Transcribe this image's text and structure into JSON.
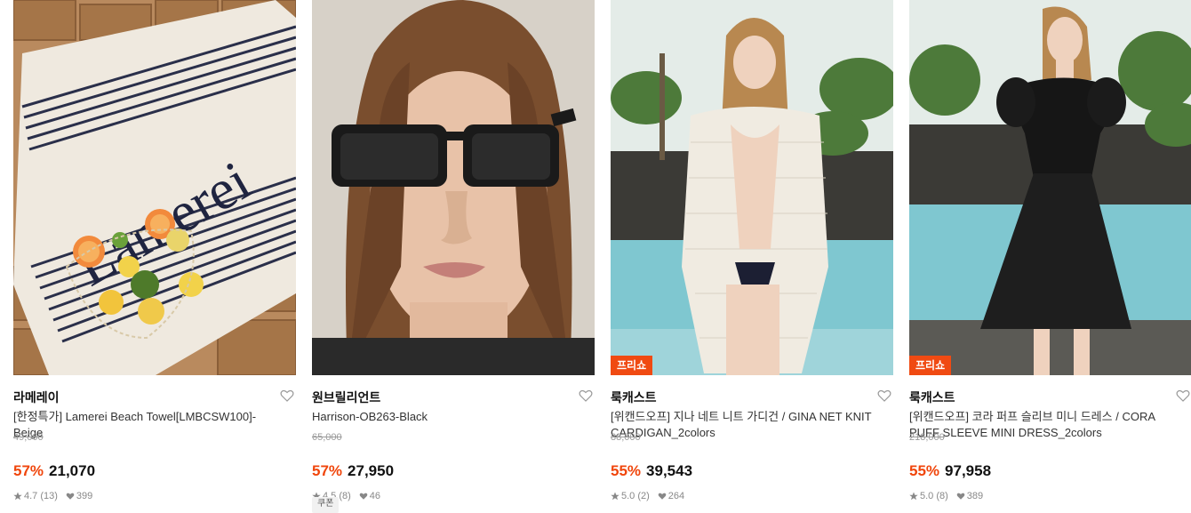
{
  "products": [
    {
      "brand": "라메레이",
      "name": "[한정특가] Lamerei Beach Towel[LMBCSW100]-Beige",
      "original_price": "49,000",
      "discount": "57%",
      "price": "21,070",
      "rating": "4.7 (13)",
      "likes": "399",
      "image_text": "Lamerei",
      "badge": "",
      "coupon": ""
    },
    {
      "brand": "원브릴리언트",
      "name": "Harrison-OB263-Black",
      "original_price": "65,000",
      "discount": "57%",
      "price": "27,950",
      "rating": "4.5 (8)",
      "likes": "46",
      "badge": "",
      "coupon": "쿠폰"
    },
    {
      "brand": "룩캐스트",
      "name": "[위캔드오프] 지나 네트 니트 가디건 / GINA NET KNIT CARDIGAN_2colors",
      "original_price": "88,000",
      "discount": "55%",
      "price": "39,543",
      "rating": "5.0 (2)",
      "likes": "264",
      "badge": "프리쇼",
      "coupon": ""
    },
    {
      "brand": "룩캐스트",
      "name": "[위캔드오프] 코라 퍼프 슬리브 미니 드레스 / CORA PUFF SLEEVE MINI DRESS_2colors",
      "original_price": "218,000",
      "discount": "55%",
      "price": "97,958",
      "rating": "5.0 (8)",
      "likes": "389",
      "badge": "프리쇼",
      "coupon": ""
    }
  ],
  "colors": {
    "discount": "#f0460c",
    "badge": "#f04a12"
  },
  "icons": {
    "wishlist": "heart-outline-icon",
    "rating": "star-icon",
    "likes": "heart-filled-icon"
  }
}
